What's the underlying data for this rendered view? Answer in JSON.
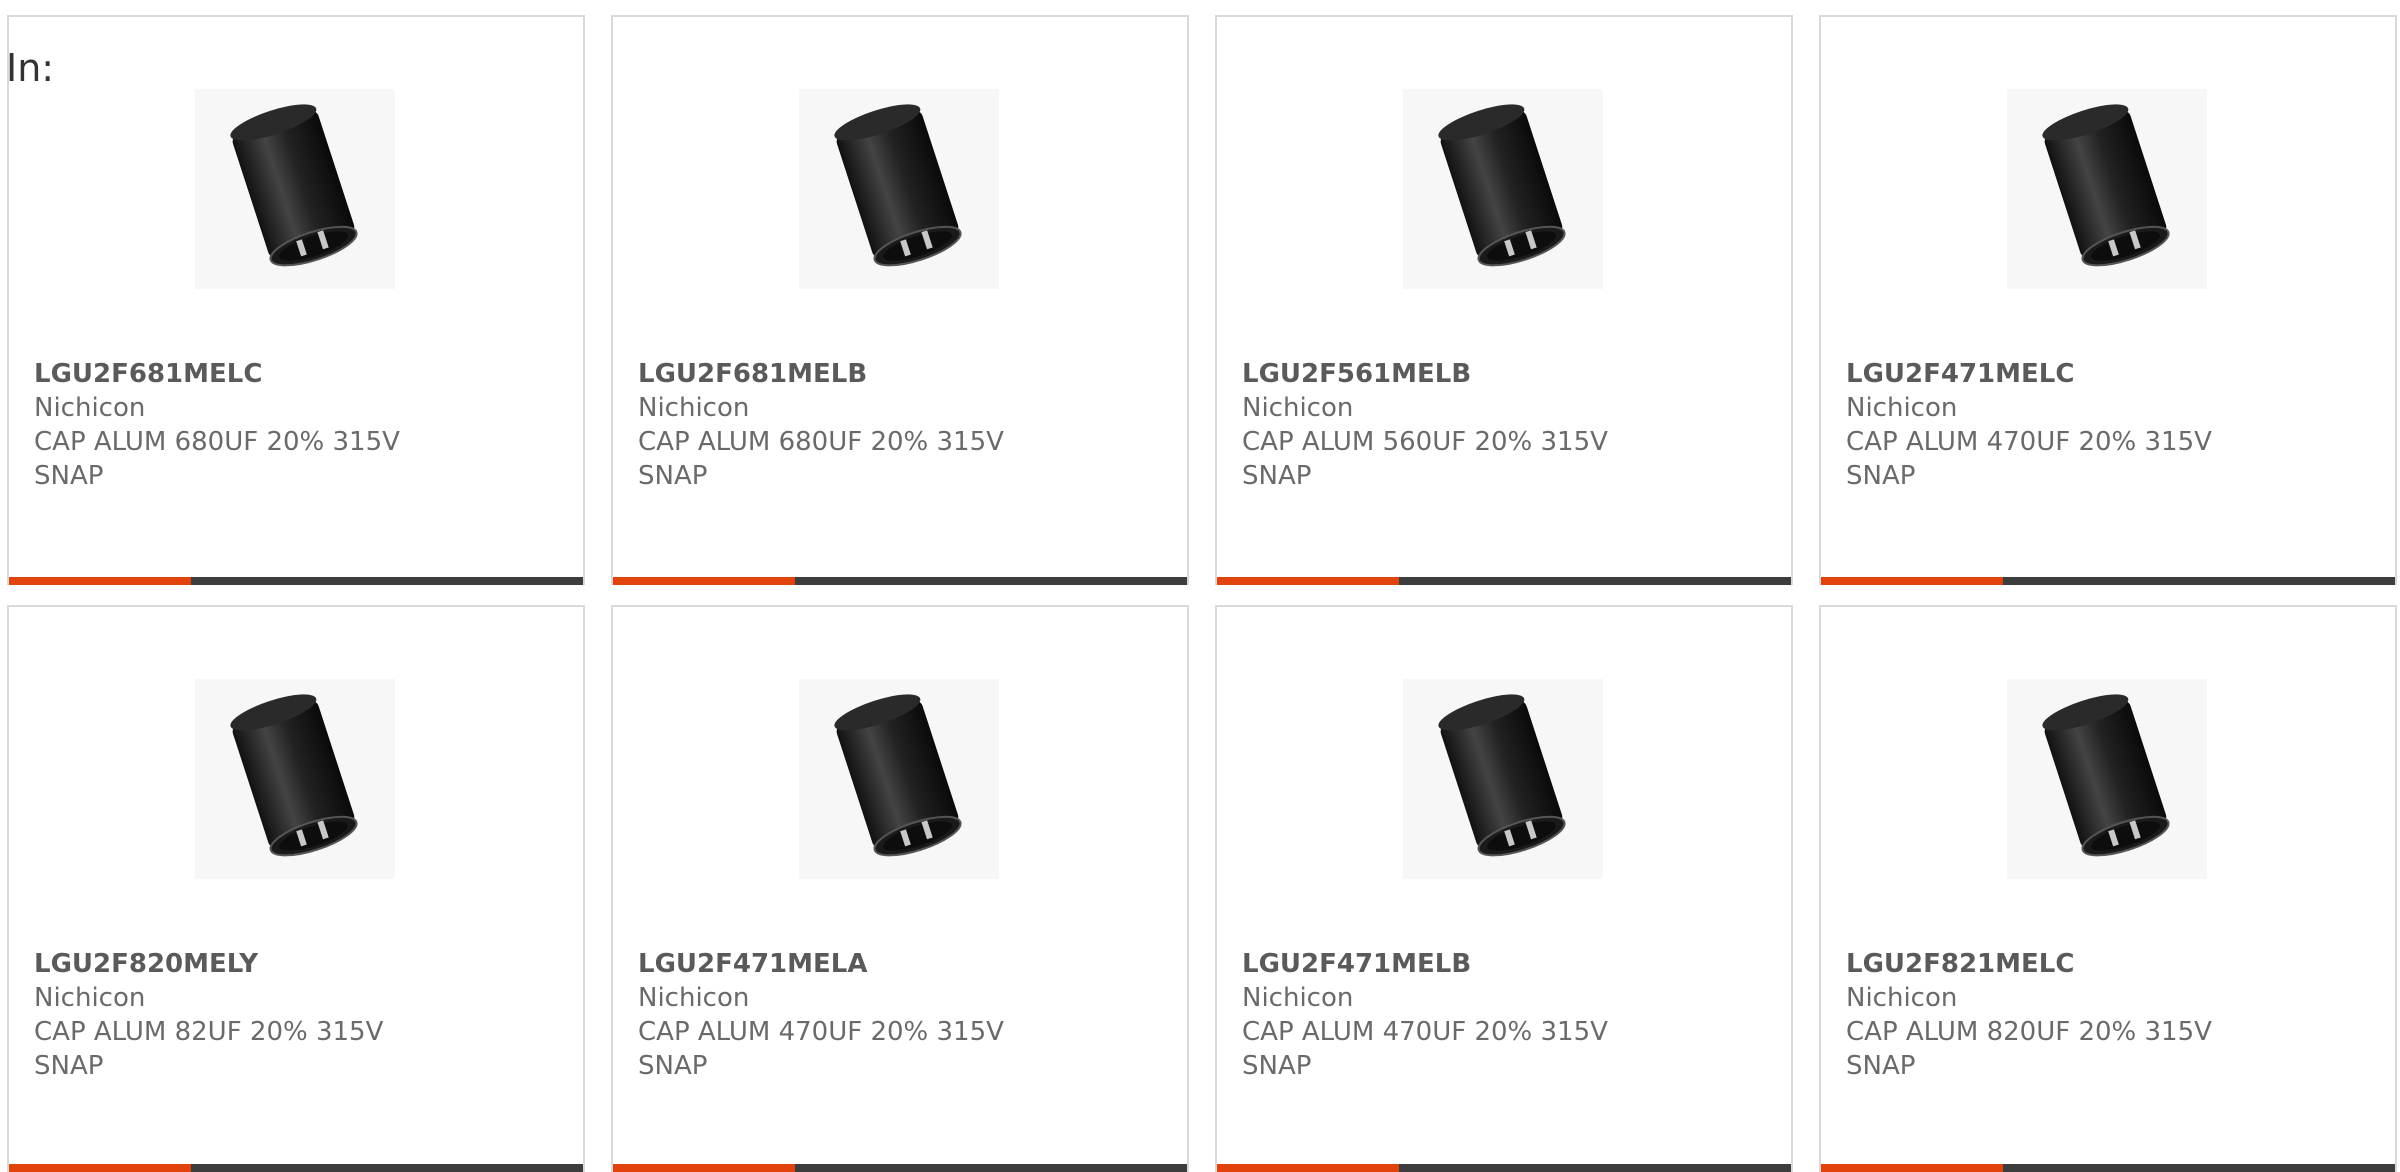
{
  "header": {
    "in_label": "In:"
  },
  "colors": {
    "accent": "#e2420c",
    "bar_dark": "#3d3d3d",
    "card_border": "#d9d9d9",
    "text_gray": "#666666"
  },
  "products": [
    {
      "part_number": "LGU2F681MELC",
      "manufacturer": "Nichicon",
      "description": "CAP ALUM 680UF 20% 315V SNAP",
      "image_icon": "capacitor-icon"
    },
    {
      "part_number": "LGU2F681MELB",
      "manufacturer": "Nichicon",
      "description": "CAP ALUM 680UF 20% 315V SNAP",
      "image_icon": "capacitor-icon"
    },
    {
      "part_number": "LGU2F561MELB",
      "manufacturer": "Nichicon",
      "description": "CAP ALUM 560UF 20% 315V SNAP",
      "image_icon": "capacitor-icon"
    },
    {
      "part_number": "LGU2F471MELC",
      "manufacturer": "Nichicon",
      "description": "CAP ALUM 470UF 20% 315V SNAP",
      "image_icon": "capacitor-icon"
    },
    {
      "part_number": "LGU2F820MELY",
      "manufacturer": "Nichicon",
      "description": "CAP ALUM 82UF 20% 315V SNAP",
      "image_icon": "capacitor-icon"
    },
    {
      "part_number": "LGU2F471MELA",
      "manufacturer": "Nichicon",
      "description": "CAP ALUM 470UF 20% 315V SNAP",
      "image_icon": "capacitor-icon"
    },
    {
      "part_number": "LGU2F471MELB",
      "manufacturer": "Nichicon",
      "description": "CAP ALUM 470UF 20% 315V SNAP",
      "image_icon": "capacitor-icon"
    },
    {
      "part_number": "LGU2F821MELC",
      "manufacturer": "Nichicon",
      "description": "CAP ALUM 820UF 20% 315V SNAP",
      "image_icon": "capacitor-icon"
    }
  ]
}
